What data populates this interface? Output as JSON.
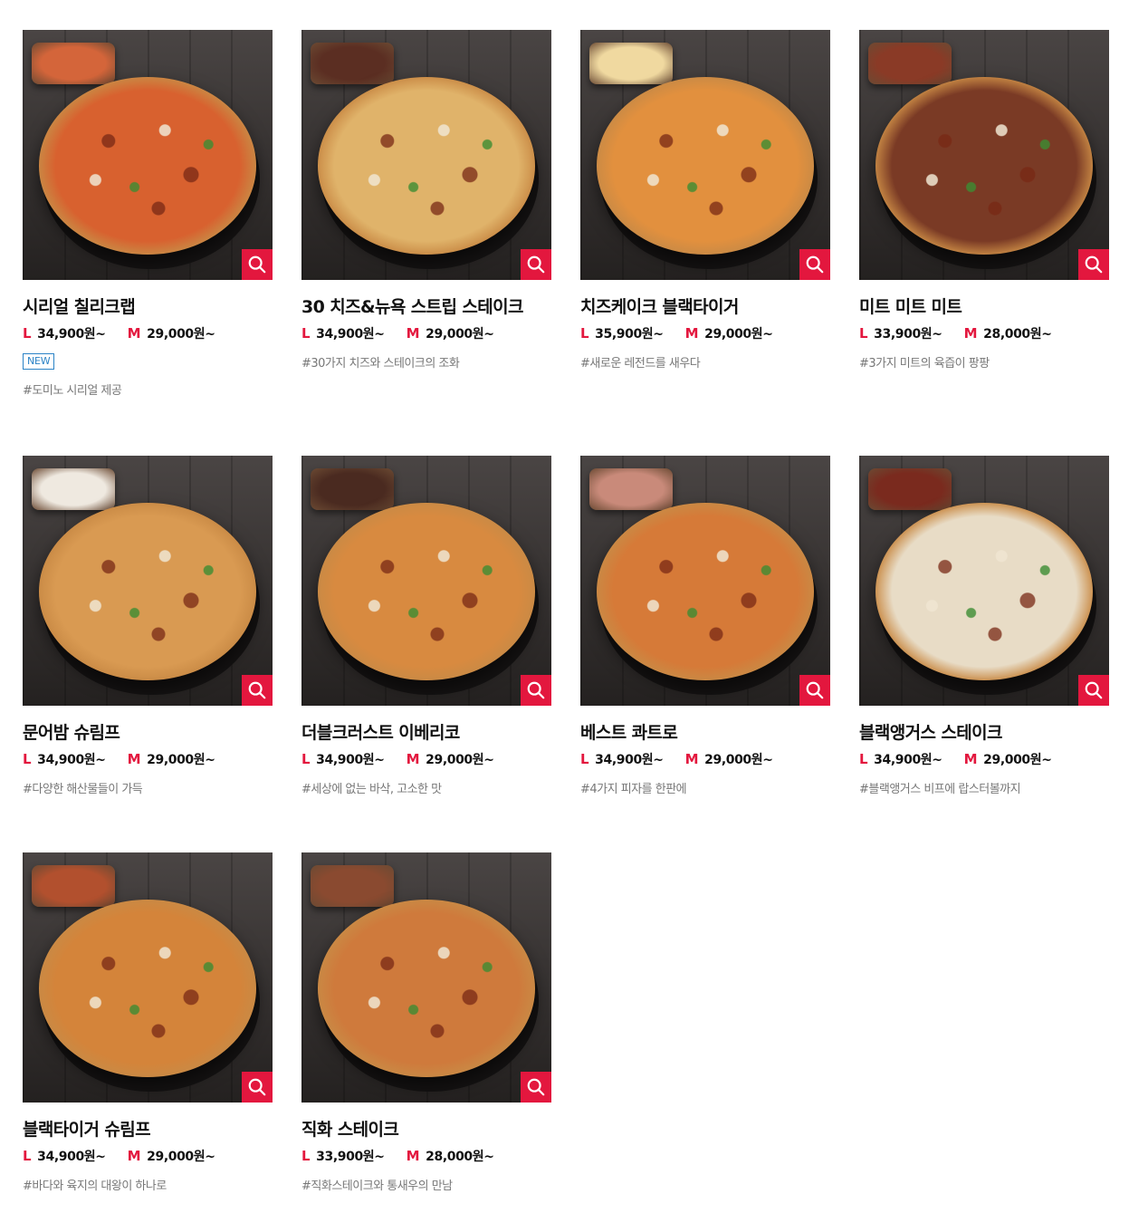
{
  "accent_color": "#e3173e",
  "badge_color": "#2b83c6",
  "zoom_icon": "magnifier-icon",
  "products": [
    {
      "name": "시리얼 칠리크랩",
      "size_l": "L",
      "price_l": "34,900원~",
      "size_m": "M",
      "price_m": "29,000원~",
      "badge": "NEW",
      "tag": "#도미노 시리얼 제공",
      "topping_color": "#d8612f",
      "side_color": "#d4653a"
    },
    {
      "name": "30 치즈&뉴욕 스트립 스테이크",
      "size_l": "L",
      "price_l": "34,900원~",
      "size_m": "M",
      "price_m": "29,000원~",
      "tag": "#30가지 치즈와 스테이크의 조화",
      "topping_color": "#e0b36a",
      "side_color": "#5b2e22"
    },
    {
      "name": "치즈케이크 블랙타이거",
      "size_l": "L",
      "price_l": "35,900원~",
      "size_m": "M",
      "price_m": "29,000원~",
      "tag": "#새로운 레전드를 새우다",
      "topping_color": "#e2903e",
      "side_color": "#f0d9a0"
    },
    {
      "name": "미트 미트 미트",
      "size_l": "L",
      "price_l": "33,900원~",
      "size_m": "M",
      "price_m": "28,000원~",
      "tag": "#3가지 미트의 육즙이 팡팡",
      "topping_color": "#7a3a25",
      "side_color": "#8a3a26"
    },
    {
      "name": "문어밤 슈림프",
      "size_l": "L",
      "price_l": "34,900원~",
      "size_m": "M",
      "price_m": "29,000원~",
      "tag": "#다양한 해산물들이 가득",
      "topping_color": "#d99a52",
      "side_color": "#efe9e0"
    },
    {
      "name": "더블크러스트 이베리코",
      "size_l": "L",
      "price_l": "34,900원~",
      "size_m": "M",
      "price_m": "29,000원~",
      "tag": "#세상에 없는 바삭, 고소한 맛",
      "topping_color": "#d88a40",
      "side_color": "#4a2a20"
    },
    {
      "name": "베스트 콰트로",
      "size_l": "L",
      "price_l": "34,900원~",
      "size_m": "M",
      "price_m": "29,000원~",
      "tag": "#4가지 피자를 한판에",
      "topping_color": "#d67a38",
      "side_color": "#c98a7a"
    },
    {
      "name": "블랙앵거스 스테이크",
      "size_l": "L",
      "price_l": "34,900원~",
      "size_m": "M",
      "price_m": "29,000원~",
      "tag": "#블랙앵거스 비프에 랍스터볼까지",
      "topping_color": "#e8dcc6",
      "side_color": "#7a2a1e"
    },
    {
      "name": "블랙타이거 슈림프",
      "size_l": "L",
      "price_l": "34,900원~",
      "size_m": "M",
      "price_m": "29,000원~",
      "tag": "#바다와 육지의 대왕이 하나로",
      "topping_color": "#d4843a",
      "side_color": "#b2502e"
    },
    {
      "name": "직화 스테이크",
      "size_l": "L",
      "price_l": "33,900원~",
      "size_m": "M",
      "price_m": "28,000원~",
      "tag": "#직화스테이크와 통새우의 만남",
      "topping_color": "#cf7a3c",
      "side_color": "#8a4a30"
    }
  ]
}
